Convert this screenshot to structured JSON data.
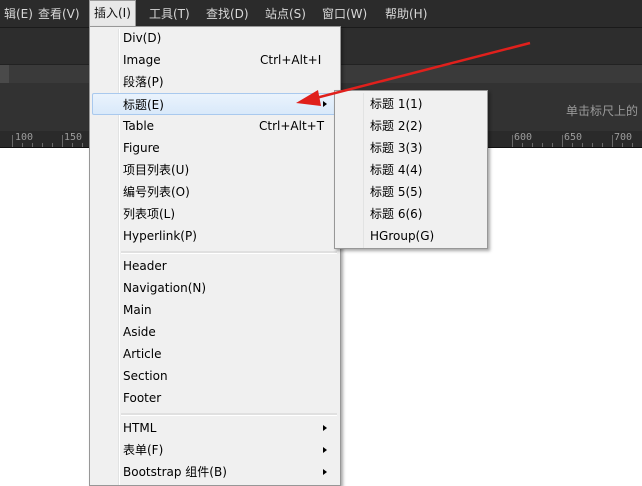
{
  "menubar": {
    "items": [
      "辑(E)",
      "查看(V)",
      "插入(I)",
      "工具(T)",
      "查找(D)",
      "站点(S)",
      "窗口(W)",
      "帮助(H)"
    ]
  },
  "hint_text": "单击标尺上的",
  "ruler": {
    "labels": [
      "100",
      "150",
      "600",
      "650",
      "700"
    ]
  },
  "insert_menu": {
    "items": [
      {
        "label": "Div(D)",
        "shortcut": ""
      },
      {
        "label": "Image",
        "shortcut": "Ctrl+Alt+I"
      },
      {
        "label": "段落(P)",
        "shortcut": ""
      },
      {
        "label": "标题(E)",
        "shortcut": ""
      },
      {
        "label": "Table",
        "shortcut": "Ctrl+Alt+T"
      },
      {
        "label": "Figure",
        "shortcut": ""
      },
      {
        "label": "项目列表(U)",
        "shortcut": ""
      },
      {
        "label": "编号列表(O)",
        "shortcut": ""
      },
      {
        "label": "列表项(L)",
        "shortcut": ""
      },
      {
        "label": "Hyperlink(P)",
        "shortcut": ""
      },
      {
        "label": "Header",
        "shortcut": ""
      },
      {
        "label": "Navigation(N)",
        "shortcut": ""
      },
      {
        "label": "Main",
        "shortcut": ""
      },
      {
        "label": "Aside",
        "shortcut": ""
      },
      {
        "label": "Article",
        "shortcut": ""
      },
      {
        "label": "Section",
        "shortcut": ""
      },
      {
        "label": "Footer",
        "shortcut": ""
      },
      {
        "label": "HTML",
        "shortcut": ""
      },
      {
        "label": "表单(F)",
        "shortcut": ""
      },
      {
        "label": "Bootstrap 组件(B)",
        "shortcut": ""
      }
    ]
  },
  "heading_submenu": {
    "items": [
      "标题 1(1)",
      "标题 2(2)",
      "标题 3(3)",
      "标题 4(4)",
      "标题 5(5)",
      "标题 6(6)",
      "HGroup(G)"
    ]
  },
  "colors": {
    "highlight": "#d9e9fa",
    "annotation_arrow": "#e0201c",
    "dark_chrome": "#2b2b2b"
  }
}
